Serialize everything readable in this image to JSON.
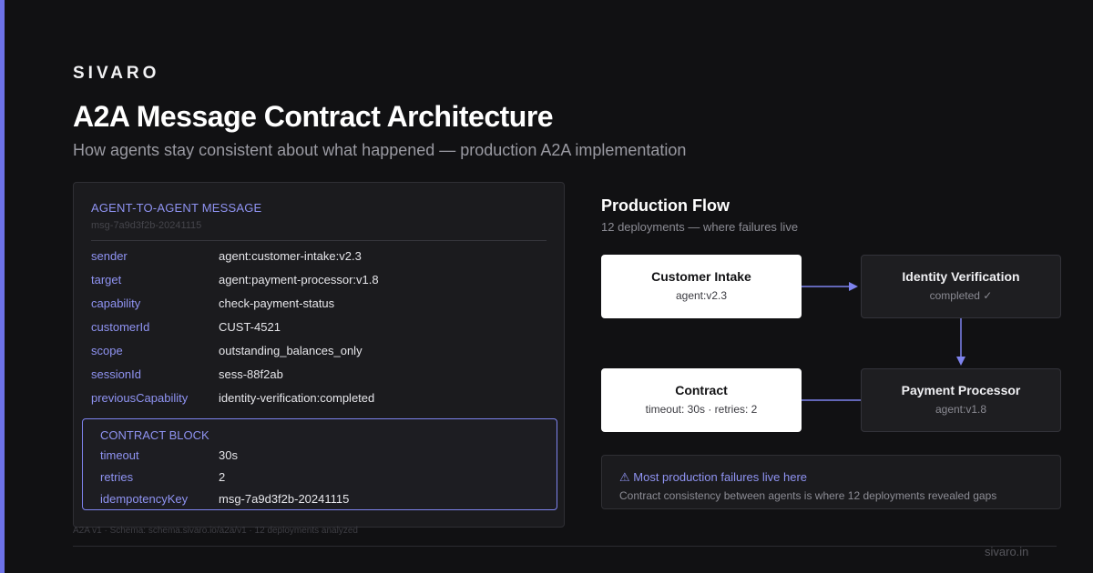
{
  "brand": "SIVARO",
  "title": "A2A Message Contract Architecture",
  "subtitle": "How agents stay consistent about what happened — production A2A implementation",
  "message_card": {
    "heading": "AGENT-TO-AGENT MESSAGE",
    "message_id": "msg-7a9d3f2b-20241115",
    "fields": [
      {
        "key": "sender",
        "value": "agent:customer-intake:v2.3"
      },
      {
        "key": "target",
        "value": "agent:payment-processor:v1.8"
      },
      {
        "key": "capability",
        "value": "check-payment-status"
      },
      {
        "key": "customerId",
        "value": "CUST-4521"
      },
      {
        "key": "scope",
        "value": "outstanding_balances_only"
      },
      {
        "key": "sessionId",
        "value": "sess-88f2ab"
      },
      {
        "key": "previousCapability",
        "value": "identity-verification:completed"
      }
    ],
    "contract_block": {
      "heading": "CONTRACT BLOCK",
      "fields": [
        {
          "key": "timeout",
          "value": "30s"
        },
        {
          "key": "retries",
          "value": "2"
        },
        {
          "key": "idempotencyKey",
          "value": "msg-7a9d3f2b-20241115"
        }
      ]
    }
  },
  "footnote": "A2A v1 · Schema: schema.sivaro.io/a2a/v1 · 12 deployments analyzed",
  "footer_domain": "sivaro.in",
  "flow": {
    "title": "Production Flow",
    "subtitle": "12 deployments — where failures live",
    "nodes": [
      {
        "title": "Customer Intake",
        "sub": "agent:v2.3"
      },
      {
        "title": "Identity Verification",
        "sub": "completed ✓"
      },
      {
        "title": "Contract",
        "sub": "timeout: 30s · retries: 2"
      },
      {
        "title": "Payment Processor",
        "sub": "agent:v1.8"
      }
    ],
    "edges": [
      {
        "from": "Customer Intake",
        "to": "Identity Verification"
      },
      {
        "from": "Identity Verification",
        "to": "Payment Processor"
      },
      {
        "from": "Contract",
        "to": "Payment Processor"
      }
    ]
  },
  "callout": {
    "title": "⚠ Most production failures live here",
    "body": "Contract consistency between agents is where 12 deployments revealed gaps"
  },
  "colors": {
    "background": "#111113",
    "accent": "#6d72e8",
    "key_text": "#8f93f2",
    "panel": "#1b1b1e"
  }
}
